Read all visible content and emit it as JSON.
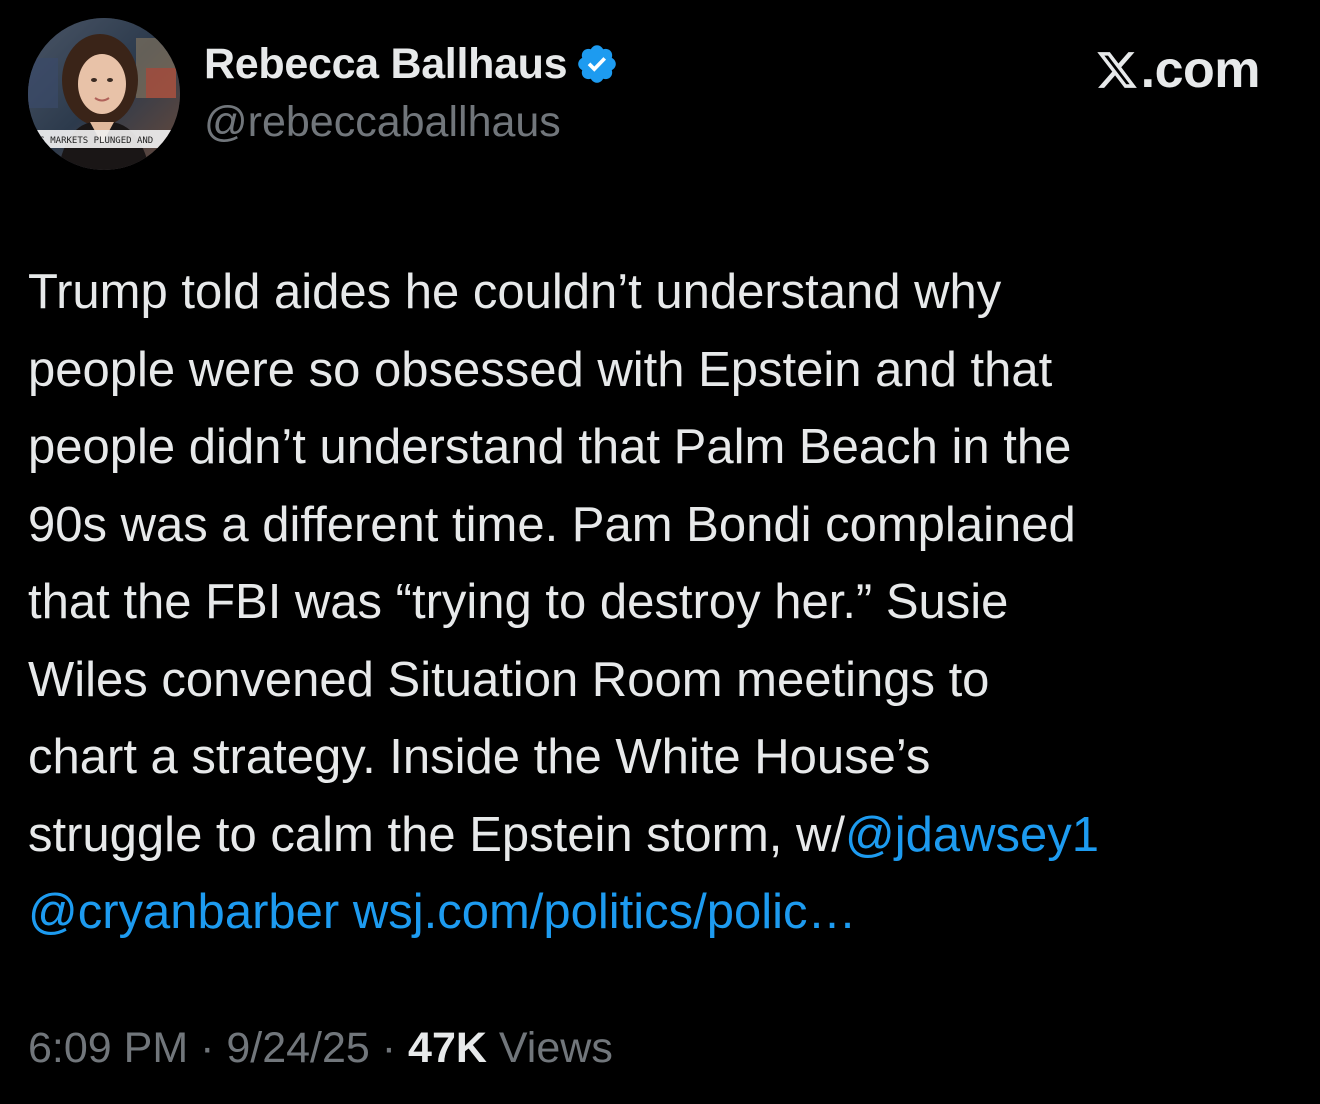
{
  "brand": {
    "label": ".com",
    "icon": "x-logo-icon"
  },
  "author": {
    "display_name": "Rebecca Ballhaus",
    "handle": "@rebeccaballhaus",
    "verified": true,
    "verified_color": "#1d9bf0",
    "avatar_icon": "avatar-photo",
    "avatar_ticker_text": "AS MARKETS PLUNGED AND"
  },
  "tweet": {
    "lines": [
      "Trump told aides he couldn’t understand why",
      "people were so obsessed with Epstein and that",
      "people didn’t understand that Palm Beach in the",
      "90s was a different time. Pam Bondi complained",
      "that the FBI was “trying to destroy her.” Susie",
      "Wiles convened Situation Room meetings to",
      "chart a strategy. Inside the White House’s",
      "struggle to calm the Epstein storm, w/"
    ],
    "mention_1": "@jdawsey1",
    "mention_2": "@cryanbarber",
    "link": "wsj.com/politics/polic…",
    "link_color": "#1d9bf0"
  },
  "meta": {
    "time": "6:09 PM",
    "separator": " · ",
    "date": "9/24/25",
    "views_count": "47K",
    "views_label": "Views"
  },
  "colors": {
    "background": "#000000",
    "text": "#e7e9ea",
    "secondary": "#71767b",
    "accent": "#1d9bf0"
  }
}
